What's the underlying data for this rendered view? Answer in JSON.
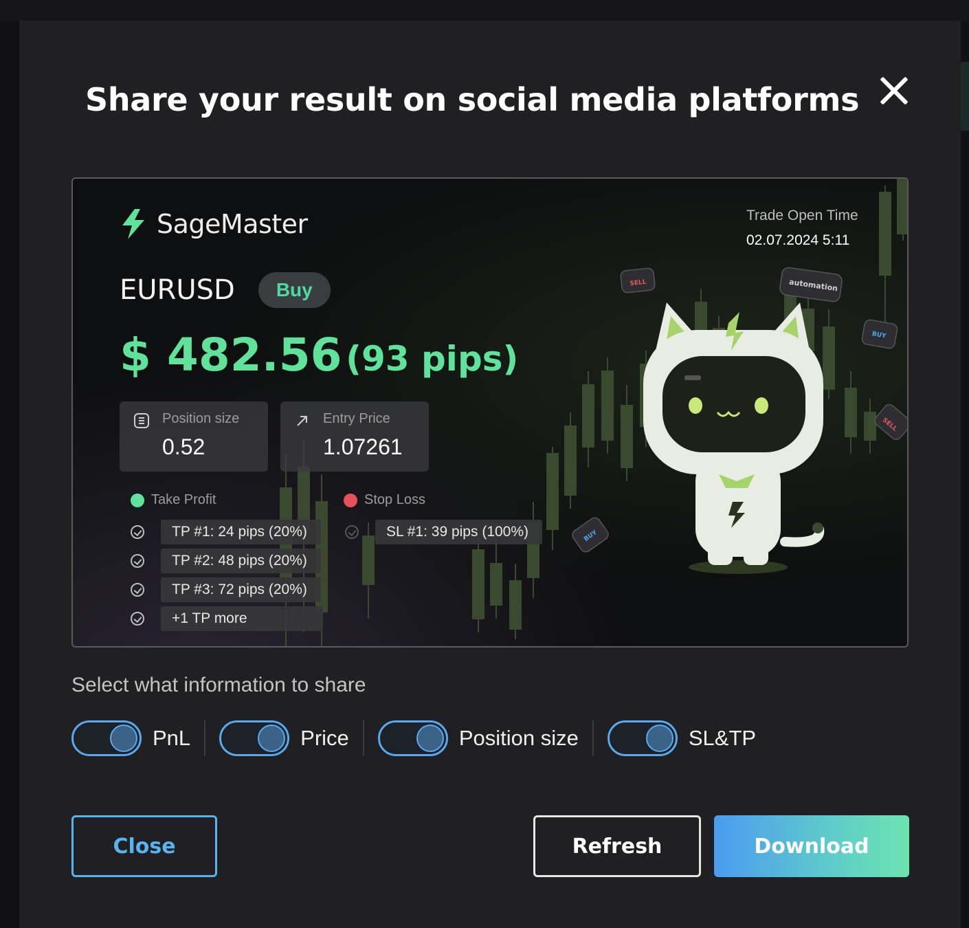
{
  "modal": {
    "title": "Share your result on social media platforms",
    "close_icon": "close-icon"
  },
  "card": {
    "brand": "SageMaster",
    "trade_open_time_label": "Trade Open Time",
    "trade_open_time_value": "02.07.2024 5:11",
    "pair": "EURUSD",
    "side": "Buy",
    "pnl_amount": "$ 482.56",
    "pnl_pips": "(93 pips)",
    "position_size_label": "Position size",
    "position_size_value": "0.52",
    "entry_price_label": "Entry Price",
    "entry_price_value": "1.07261",
    "take_profit_label": "Take Profit",
    "stop_loss_label": "Stop Loss",
    "take_profits": [
      "TP #1: 24 pips (20%)",
      "TP #2: 48 pips (20%)",
      "TP #3: 72 pips (20%)",
      "+1 TP more"
    ],
    "stop_losses": [
      "SL #1: 39 pips (100%)"
    ],
    "mascot_tags": [
      "SELL",
      "automation",
      "BUY",
      "SELL",
      "BUY"
    ],
    "colors": {
      "profit": "#5fe29a",
      "take_profit_dot": "#5fe29a",
      "stop_loss_dot": "#e8505b",
      "buy": "#4fd8a2"
    }
  },
  "share": {
    "label": "Select what information to share",
    "toggles": [
      {
        "label": "PnL",
        "on": true
      },
      {
        "label": "Price",
        "on": true
      },
      {
        "label": "Position size",
        "on": true
      },
      {
        "label": "SL&TP",
        "on": true
      }
    ]
  },
  "buttons": {
    "close": "Close",
    "refresh": "Refresh",
    "download": "Download"
  },
  "colors": {
    "accent": "#58b3ee",
    "modal_bg": "#202022"
  }
}
